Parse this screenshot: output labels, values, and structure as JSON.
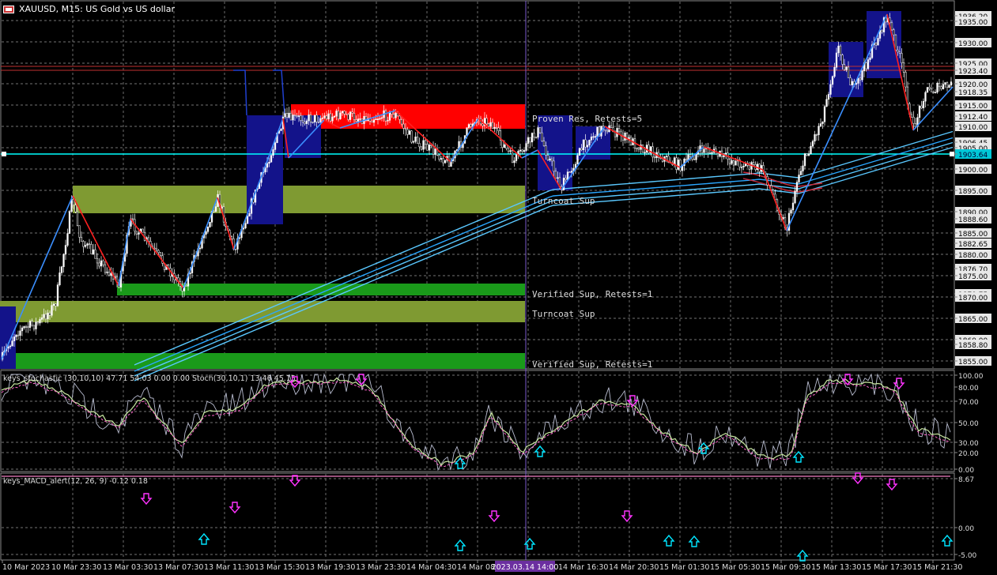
{
  "window": {
    "symbol_title": "XAUUSD, M15:  US Gold vs US dollar",
    "icon": "chart-window-icon"
  },
  "main_chart": {
    "price_axis_labels": [
      "1936.20",
      "1935.00",
      "1930.00",
      "1925.00",
      "1923.40",
      "1920.00",
      "1918.35",
      "1915.00",
      "1912.40",
      "1910.00",
      "1906.45",
      "1905.00",
      "1903.64",
      "1900.00",
      "1895.00",
      "1890.00",
      "1888.60",
      "1885.00",
      "1882.65",
      "1880.00",
      "1876.70",
      "1875.00",
      "1870.75",
      "1870.00",
      "1865.00",
      "1860.00",
      "1858.80",
      "1855.00"
    ],
    "current_price": "1903.64",
    "zone_labels": {
      "proven_res": "Proven Res, Retests=5",
      "turncoat_sup_1": "Turncoat Sup",
      "verified_sup_1": "Verified Sup, Retests=1",
      "turncoat_sup_2": "Turncoat Sup",
      "verified_sup_2": "Verified Sup, Retests=1"
    }
  },
  "stoch_panel": {
    "title": "keys_stochastic (30,10,10) 47.71 54.03 0.00 0.00 Stoch(30,10,1) 13.46 45.15",
    "levels": [
      "100.00",
      "80.00",
      "70.00",
      "50.00",
      "30.00",
      "20.00",
      "0.00"
    ]
  },
  "macd_panel": {
    "title": "keys_MACD_alert(12, 26, 9) -0.12 0.18",
    "levels": [
      "8.67",
      "0.00",
      "-5.00"
    ]
  },
  "time_axis": {
    "labels": [
      "10 Mar 2023",
      "10 Mar 23:30",
      "13 Mar 03:30",
      "13 Mar 07:30",
      "13 Mar 11:30",
      "13 Mar 15:30",
      "13 Mar 19:30",
      "13 Mar 23:30",
      "14 Mar 04:30",
      "14 Mar 08:30",
      "14 Mar 16:30",
      "14 Mar 20:30",
      "15 Mar 01:30",
      "15 Mar 05:30",
      "15 Mar 09:30",
      "15 Mar 13:30",
      "15 Mar 17:30",
      "15 Mar 21:30"
    ],
    "cursor_time": "2023.03.14 14:00"
  },
  "colors": {
    "background": "#000000",
    "grid": "#7f7f7f",
    "candle": "#ffffff",
    "zone_resistance": "#ff0000",
    "zone_turncoat": "#7f9a32",
    "zone_verified": "#1a9a1a",
    "zigzag_up": "#3b8fff",
    "zigzag_down": "#ff2020",
    "ema_band": "#38b6ff",
    "blue_box": "#13138a",
    "current_price_line": "#00ffff",
    "signal_up_arrow": "#00e5ff",
    "signal_down_arrow": "#ff00ff"
  }
}
